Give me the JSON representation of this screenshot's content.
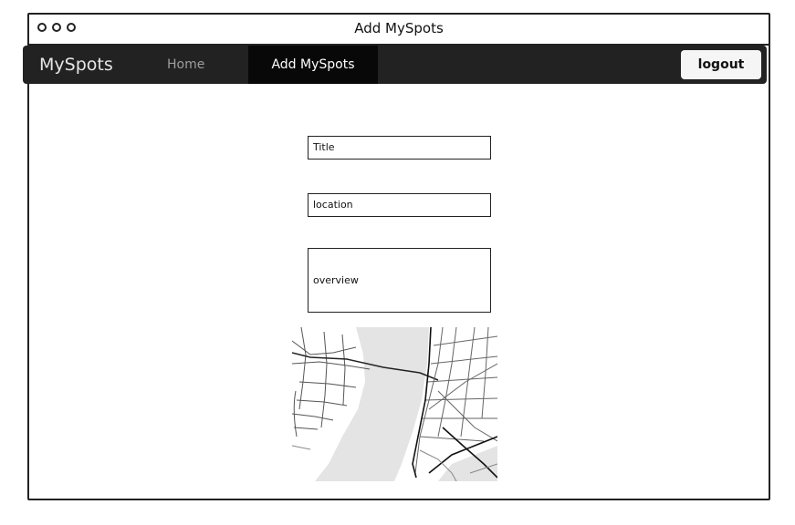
{
  "window": {
    "title": "Add MySpots"
  },
  "navbar": {
    "brand": "MySpots",
    "items": [
      {
        "label": "Home",
        "active": false
      },
      {
        "label": "Add MySpots",
        "active": true
      }
    ],
    "logout_label": "logout"
  },
  "form": {
    "title_placeholder": "Title",
    "location_placeholder": "location",
    "overview_placeholder": "overview"
  },
  "map": {
    "icon": "map-icon"
  },
  "colors": {
    "navbar_bg": "#222222",
    "nav_active_bg": "#080808",
    "brand_text": "#e6e6e6",
    "nav_text": "#9d9d9d"
  }
}
